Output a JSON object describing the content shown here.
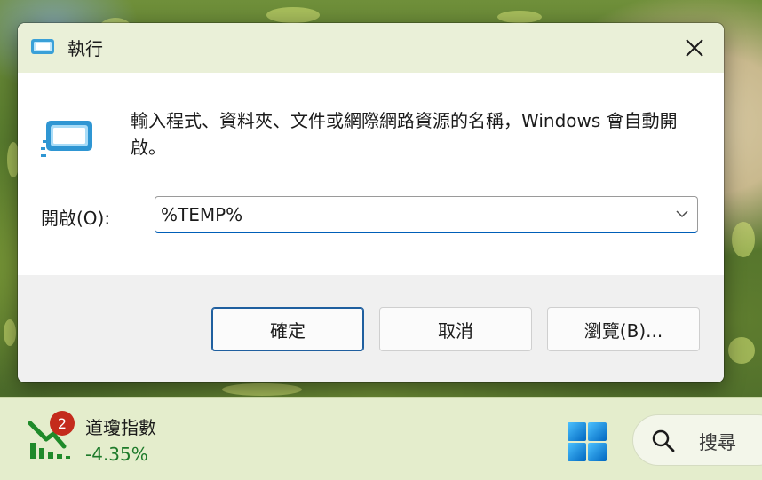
{
  "dialog": {
    "title": "執行",
    "description": "輸入程式、資料夾、文件或網際網路資源的名稱，Windows 會自動開啟。",
    "open_label": "開啟(O):",
    "open_value": "%TEMP%",
    "buttons": {
      "ok": "確定",
      "cancel": "取消",
      "browse": "瀏覽(B)..."
    },
    "icons": {
      "title": "run-icon",
      "content": "run-icon",
      "close": "close-icon",
      "dropdown": "chevron-down-icon"
    }
  },
  "taskbar": {
    "widget": {
      "badge_count": "2",
      "title": "道瓊指數",
      "value": "-4.35%",
      "icon": "stock-down-chart-icon",
      "value_color": "#1d7a2a"
    },
    "start_icon": "windows-logo-icon",
    "search": {
      "placeholder": "搜尋",
      "icon": "search-icon"
    }
  },
  "colors": {
    "accent": "#005fb8",
    "primary_button_border": "#1f5f9f",
    "badge": "#c42b1c"
  }
}
